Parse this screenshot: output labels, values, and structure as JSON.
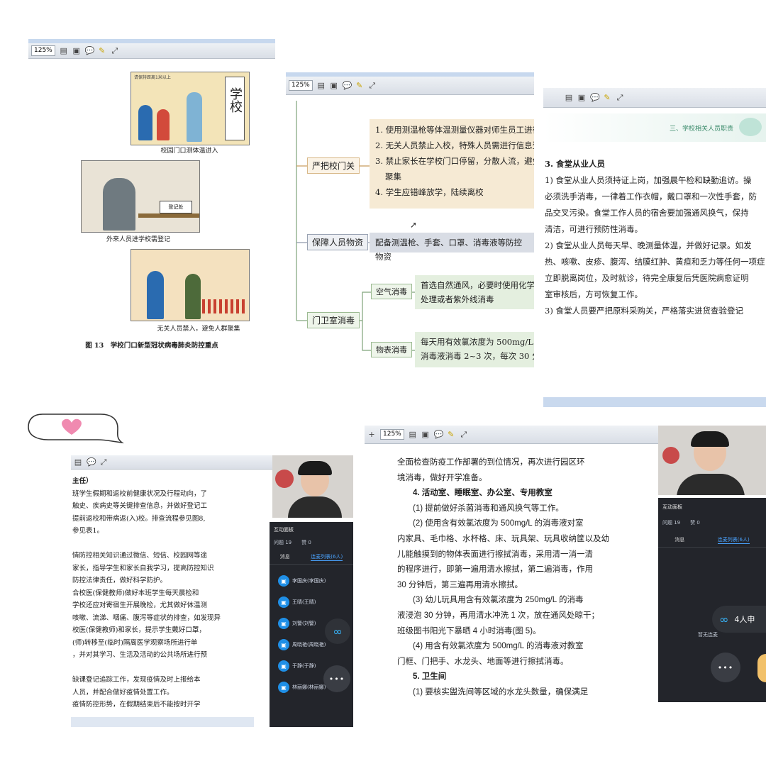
{
  "viewer": {
    "zoom": "125%"
  },
  "shot1": {
    "sign_text": "学校",
    "top_caption": "请保持距离1米以上",
    "caption1": "校园门口测体温进入",
    "visitor_book": "登记处",
    "caption2": "外来人员进学校需登记",
    "caption3": "无关人员禁入，避免人群聚集",
    "figure_caption": "图 13　学校门口新型冠状病毒肺炎防控重点"
  },
  "shot2": {
    "node1": "严把校门关",
    "items1": [
      "1. 使用测温枪等体温测量仪器对师生员工进行晨",
      "2. 无关人员禁止入校，特殊人员需进行信息登记",
      "3. 禁止家长在学校门口停留，分散人流，避免人",
      "聚集",
      "4. 学生应错峰放学，陆续离校"
    ],
    "node2": "保障人员物资",
    "item2": "配备测温枪、手套、口罩、消毒液等防控物资",
    "node3": "门卫室消毒",
    "sub1": "空气消毒",
    "sub1_text": [
      "首选自然通风，必要时使用化学消毒",
      "处理或者紫外线消毒"
    ],
    "sub2": "物表消毒",
    "sub2_text": [
      "每天用有效氯浓度为 500mg/L 的含",
      "消毒液消毒 2~3 次，每次 30 分钟"
    ]
  },
  "shot3": {
    "header": "三、学校相关人员职责",
    "lines": [
      "3. 食堂从业人员",
      "1) 食堂从业人员须持证上岗，加强晨午检和缺勤追访。操",
      "必须洗手消毒，一律着工作衣帽，戴口罩和一次性手套，防",
      "品交叉污染。食堂工作人员的宿舍要加强通风换气，保持",
      "清洁，可进行预防性消毒。",
      "2) 食堂从业人员每天早、晚测量体温，并做好记录。如发",
      "热、咳嗽、皮疹、腹泻、结膜红肿、黄疸和乏力等任何一项症",
      "立即脱离岗位，及时就诊，待完全康复后凭医院病愈证明",
      "室审核后，方可恢复工作。",
      "3) 食堂人员要严把原料采购关，严格落实进货查验登记"
    ]
  },
  "shot4": {
    "lines": [
      "主任）",
      "班学生假期和返校前健康状况及行程动向，了",
      "触史、疾病史等关键排查信息，并做好登记工",
      "提前返校和带病返(入)校。排查流程参见图8,",
      "参见表1。",
      "",
      "情防控相关知识通过微信、短信、校园网等途",
      "家长，指导学生和家长自我学习，提高防控知识",
      "防控法律责任，做好科学防护。",
      "合校医(保健教师)做好本班学生每天晨检和",
      "学校还应对寄宿生开展晚检，尤其做好体温测",
      "咳嗽、流涕、咽痛、腹泻等症状的排查，如发现异",
      "校医(保健教师)和家长，提示学生戴好口罩，",
      "(师)转移至(临时)隔离医学观察场所进行单",
      "，并对其学习、生活及活动的公共场所进行预",
      "",
      "缺课登记追踪工作，发现疫情及时上报给本",
      "人员，并配合做好疫情处置工作。",
      "疫情防控形势，在假期结束后不能按时开学"
    ],
    "panel_title": "互动面板",
    "counts": "问题 19　　赞 0",
    "tabs": [
      "消息",
      "连麦列表(6人)"
    ],
    "people": [
      "李国庆(李国庆)",
      "王晴(王晴)",
      "刘警(刘警)",
      "周晓艳(周晓艳)",
      "于静(于静)",
      "林丽娜(林丽娜)"
    ]
  },
  "shot5": {
    "lines": [
      "全面检查防疫工作部署的到位情况，再次进行园区环",
      "境消毒，做好开学准备。",
      "4. 活动室、睡眠室、办公室、专用教室",
      "(1) 提前做好杀菌消毒和通风换气等工作。",
      "(2) 使用含有效氯浓度为 500mg/L 的消毒液对室",
      "内家具、毛巾格、水杯格、床、玩具架、玩具收纳筐以及幼",
      "儿能触摸到的物体表面进行擦拭消毒，采用清一消一清",
      "的程序进行，即第一遍用清水擦拭，第二遍消毒，作用",
      "30 分钟后，第三遍再用清水擦拭。",
      "(3) 幼儿玩具用含有效氯浓度为 250mg/L 的消毒",
      "液浸泡 30 分钟，再用清水冲洗 1 次，放在通风处晾干；",
      "班级图书阳光下暴晒 4 小时消毒(图 5)。",
      "(4) 用含有效氯浓度为 500mg/L 的消毒液对教室",
      "门框、门把手、水龙头、地面等进行擦拭消毒。",
      "5. 卫生间",
      "(1) 要核实盥洗间等区域的水龙头数量，确保满足"
    ],
    "panel_title": "互动面板",
    "counts": "问题 19　　赞 0",
    "tabs": [
      "消息",
      "连麦列表(6人)"
    ],
    "empty_text": "暂无连麦",
    "live_badge": "4人申",
    "more": "•••"
  },
  "colors": {
    "accent_orange": "#f2e3c7",
    "accent_gray": "#d8dde6",
    "accent_green": "#e4efdf",
    "panel_dark": "#23252b",
    "heart": "#f08ab0"
  }
}
